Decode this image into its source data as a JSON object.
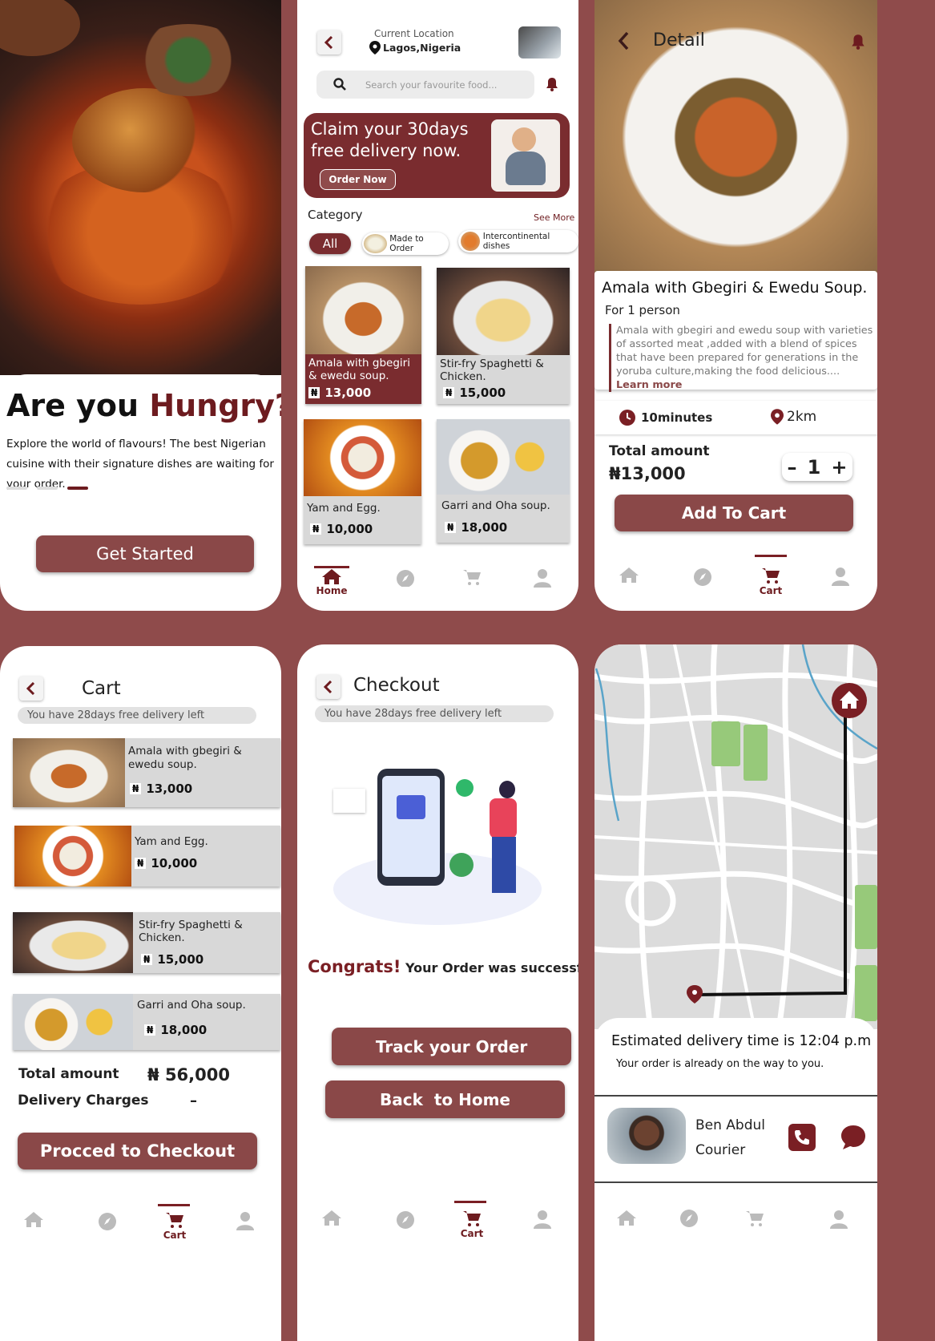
{
  "colors": {
    "bg": "#8f4b4b",
    "primary": "#8a4848",
    "dark": "#6d1b1f",
    "light": "#d8d8d8"
  },
  "onboard": {
    "title_plain": "Are you ",
    "title_accent": "Hungry?",
    "desc": "Explore the world of flavours! The best Nigerian cuisine with their signature dishes are waiting for your order.",
    "cta": "Get Started"
  },
  "home": {
    "loc_label": "Current Location",
    "loc_value": "Lagos,Nigeria",
    "search_placeholder": "Search your favourite food...",
    "promo_text": "Claim your 30days free delivery now.",
    "promo_btn": "Order Now",
    "category_title": "Category",
    "see_more": "See More",
    "chips": [
      "All",
      "Made to Order",
      "Intercontinental dishes"
    ],
    "foods": [
      {
        "name": "Amala with gbegiri & ewedu soup.",
        "price": "13,000"
      },
      {
        "name": "Stir-fry Spaghetti & Chicken.",
        "price": "15,000"
      },
      {
        "name": "Yam and Egg.",
        "price": "10,000"
      },
      {
        "name": "Garri and Oha soup.",
        "price": "18,000"
      }
    ],
    "nav_home": "Home"
  },
  "detail": {
    "header": "Detail",
    "title": "Amala with Gbegiri & Ewedu Soup.",
    "serving": "For 1 person",
    "desc": "Amala with gbegiri and ewedu soup with varieties of assorted meat ,added with a blend of spices that have been prepared for generations in the yoruba culture,making the food delicious....",
    "learn_more": "Learn more",
    "time": "10minutes",
    "distance": "2km",
    "total_label": "Total amount",
    "total_value": "₦13,000",
    "minus": "–",
    "qty": "1",
    "plus": "+",
    "cta": "Add To Cart",
    "nav_cart": "Cart"
  },
  "cart": {
    "header": "Cart",
    "free_note": "You have 28days free delivery left",
    "items": [
      {
        "name": "Amala with gbegiri & ewedu soup.",
        "price": "13,000"
      },
      {
        "name": "Yam and Egg.",
        "price": "10,000"
      },
      {
        "name": "Stir-fry Spaghetti & Chicken.",
        "price": "15,000"
      },
      {
        "name": "Garri and Oha soup.",
        "price": "18,000"
      }
    ],
    "total_label": "Total amount",
    "total_value": "56,000",
    "naira": "₦",
    "delivery_label": "Delivery Charges",
    "delivery_value": "–",
    "cta": "Procced to Checkout",
    "nav_cart": "Cart"
  },
  "checkout": {
    "header": "Checkout",
    "free_note": "You have 28days free delivery left",
    "congrats": "Congrats!",
    "message": " Your Order was successful.",
    "track": "Track your Order",
    "back_home": "Back  to Home",
    "nav_cart": "Cart"
  },
  "tracking": {
    "eta": "Estimated delivery time is 12:04 p.m",
    "sub": "Your order is already on the way to you.",
    "courier_name": "Ben Abdul",
    "courier_role": "Courier"
  },
  "naira_symbol": "₦"
}
